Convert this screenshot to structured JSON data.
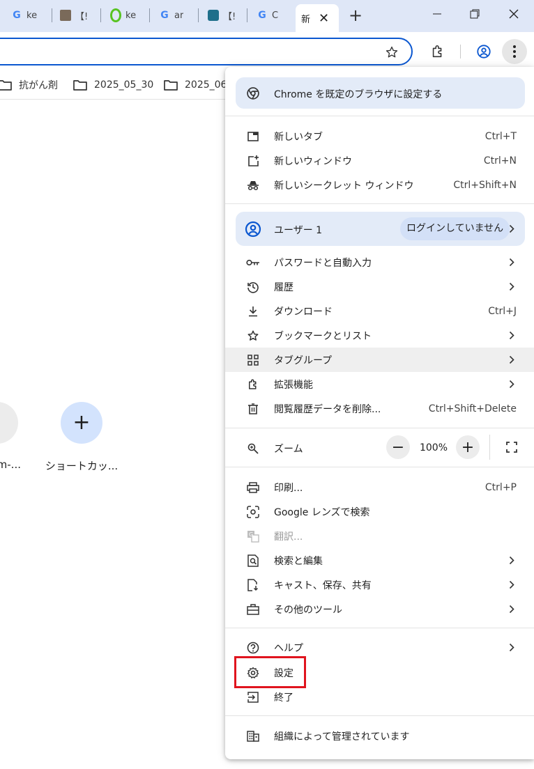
{
  "tabs": [
    {
      "title": "ke",
      "favicon": "google-icon"
    },
    {
      "title": "【!",
      "favicon": "photo-favicon"
    },
    {
      "title": "ke",
      "favicon": "green-circle-favicon"
    },
    {
      "title": "ar",
      "favicon": "google-icon"
    },
    {
      "title": "【!",
      "favicon": "teal-square-favicon"
    },
    {
      "title": "C",
      "favicon": "google-icon"
    },
    {
      "title": "新",
      "active": true
    }
  ],
  "new_tab_symbol": "+",
  "bookmarks": [
    {
      "label": "抗がん剤",
      "icon": "folder-icon"
    },
    {
      "label": "2025_05_30",
      "icon": "folder-icon"
    },
    {
      "label": "2025_06_",
      "icon": "folder-icon"
    }
  ],
  "shortcuts": [
    {
      "label": "m-...",
      "icon": "site-icon"
    },
    {
      "label": "ショートカッ...",
      "icon": "plus-icon",
      "symbol": "+"
    }
  ],
  "menu": {
    "set_default": "Chrome を既定のブラウザに設定する",
    "new_tab": {
      "label": "新しいタブ",
      "shortcut": "Ctrl+T"
    },
    "new_window": {
      "label": "新しいウィンドウ",
      "shortcut": "Ctrl+N"
    },
    "incognito": {
      "label": "新しいシークレット ウィンドウ",
      "shortcut": "Ctrl+Shift+N"
    },
    "profile": {
      "name": "ユーザー 1",
      "status": "ログインしていません"
    },
    "passwords": {
      "label": "パスワードと自動入力"
    },
    "history": {
      "label": "履歴"
    },
    "downloads": {
      "label": "ダウンロード",
      "shortcut": "Ctrl+J"
    },
    "bookmarks": {
      "label": "ブックマークとリスト"
    },
    "tab_groups": {
      "label": "タブグループ"
    },
    "extensions": {
      "label": "拡張機能"
    },
    "clear_data": {
      "label": "閲覧履歴データを削除...",
      "shortcut": "Ctrl+Shift+Delete"
    },
    "zoom": {
      "label": "ズーム",
      "minus": "−",
      "value": "100%",
      "plus": "+"
    },
    "print": {
      "label": "印刷...",
      "shortcut": "Ctrl+P"
    },
    "lens": {
      "label": "Google レンズで検索"
    },
    "translate": {
      "label": "翻訳..."
    },
    "find_edit": {
      "label": "検索と編集"
    },
    "cast_save_share": {
      "label": "キャスト、保存、共有"
    },
    "more_tools": {
      "label": "その他のツール"
    },
    "help": {
      "label": "ヘルプ"
    },
    "settings": {
      "label": "設定"
    },
    "exit": {
      "label": "終了"
    },
    "managed": {
      "label": "組織によって管理されています"
    }
  },
  "colors": {
    "accent": "#0b57d0",
    "highlight_box": "#e0141e",
    "pill_bg": "#e3ebf8",
    "titlebar": "#dfe7f7"
  }
}
